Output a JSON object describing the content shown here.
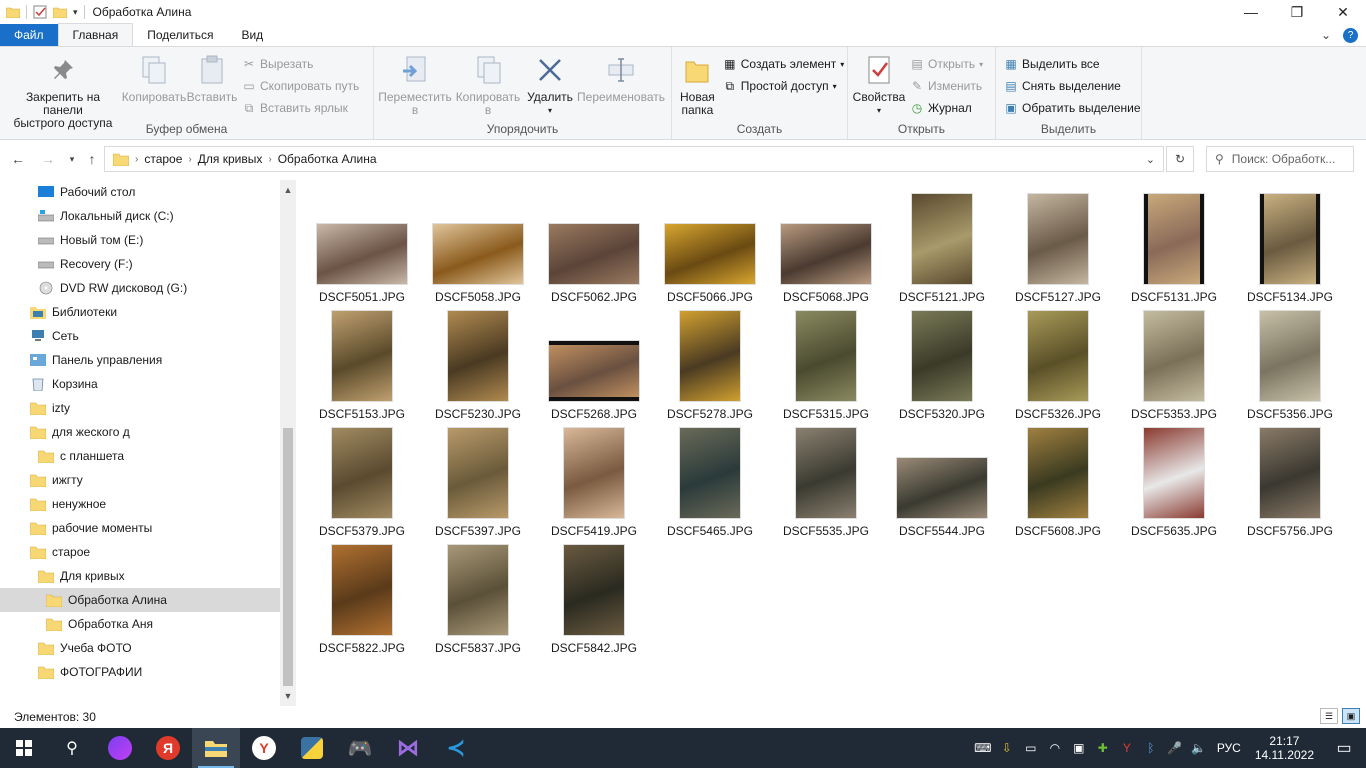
{
  "window": {
    "title": "Обработка Алина",
    "minimize": "—",
    "maximize": "❐",
    "close": "✕"
  },
  "menu": {
    "file": "Файл",
    "tabs": [
      "Главная",
      "Поделиться",
      "Вид"
    ],
    "active_tab": "Главная"
  },
  "ribbon": {
    "clipboard": {
      "group": "Буфер обмена",
      "pin": "Закрепить на панели быстрого доступа",
      "pin_l1": "Закрепить на панели",
      "pin_l2": "быстрого доступа",
      "copy": "Копировать",
      "paste": "Вставить",
      "cut": "Вырезать",
      "copy_path": "Скопировать путь",
      "paste_shortcut": "Вставить ярлык"
    },
    "organize": {
      "group": "Упорядочить",
      "move_l1": "Переместить",
      "move_l2": "в",
      "copyto_l1": "Копировать",
      "copyto_l2": "в",
      "delete": "Удалить",
      "rename": "Переименовать"
    },
    "new": {
      "group": "Создать",
      "new_folder_l1": "Новая",
      "new_folder_l2": "папка",
      "new_item": "Создать элемент",
      "easy_access": "Простой доступ"
    },
    "open": {
      "group": "Открыть",
      "properties": "Свойства",
      "open": "Открыть",
      "edit": "Изменить",
      "history": "Журнал"
    },
    "select": {
      "group": "Выделить",
      "select_all": "Выделить все",
      "select_none": "Снять выделение",
      "invert": "Обратить выделение"
    }
  },
  "address": {
    "crumbs": [
      "старое",
      "Для кривых",
      "Обработка Алина"
    ],
    "search_placeholder": "Поиск: Обработк..."
  },
  "nav": [
    {
      "label": "Рабочий стол",
      "icon": "desktop-icon",
      "x": 38
    },
    {
      "label": "Локальный диск (C:)",
      "icon": "drive-c-icon",
      "x": 38
    },
    {
      "label": "Новый том (E:)",
      "icon": "drive-icon",
      "x": 38
    },
    {
      "label": "Recovery (F:)",
      "icon": "drive-icon",
      "x": 38
    },
    {
      "label": "DVD RW дисковод (G:)",
      "icon": "dvd-icon",
      "x": 38
    },
    {
      "label": "Библиотеки",
      "icon": "libraries-icon",
      "x": 30
    },
    {
      "label": "Сеть",
      "icon": "network-icon",
      "x": 30
    },
    {
      "label": "Панель управления",
      "icon": "control-panel-icon",
      "x": 30
    },
    {
      "label": "Корзина",
      "icon": "recycle-bin-icon",
      "x": 30
    },
    {
      "label": "izty",
      "icon": "folder-icon",
      "x": 30
    },
    {
      "label": "для жеского д",
      "icon": "folder-icon",
      "x": 30
    },
    {
      "label": "с планшета",
      "icon": "folder-icon",
      "x": 38
    },
    {
      "label": "ижгту",
      "icon": "folder-icon",
      "x": 30
    },
    {
      "label": "ненужное",
      "icon": "folder-icon",
      "x": 30
    },
    {
      "label": "рабочие моменты",
      "icon": "folder-icon",
      "x": 30
    },
    {
      "label": "старое",
      "icon": "folder-icon",
      "x": 30
    },
    {
      "label": "Для кривых",
      "icon": "folder-icon",
      "x": 38
    },
    {
      "label": "Обработка Алина",
      "icon": "folder-icon",
      "x": 46,
      "selected": true
    },
    {
      "label": "Обработка Аня",
      "icon": "folder-icon",
      "x": 46
    },
    {
      "label": "Учеба ФОТО",
      "icon": "folder-icon",
      "x": 38
    },
    {
      "label": "ФОТОГРАФИИ",
      "icon": "folder-icon",
      "x": 38
    }
  ],
  "files": [
    {
      "name": "DSCF5051.JPG",
      "orient": "l",
      "c1": "#6b5345",
      "c2": "#c9b8a8"
    },
    {
      "name": "DSCF5058.JPG",
      "orient": "l",
      "c1": "#8a5a1c",
      "c2": "#e0c59a"
    },
    {
      "name": "DSCF5062.JPG",
      "orient": "l",
      "c1": "#5b4438",
      "c2": "#9a7a60"
    },
    {
      "name": "DSCF5066.JPG",
      "orient": "l",
      "c1": "#6a4a12",
      "c2": "#d8a630"
    },
    {
      "name": "DSCF5068.JPG",
      "orient": "l",
      "c1": "#4a3a30",
      "c2": "#b89a80"
    },
    {
      "name": "DSCF5121.JPG",
      "orient": "p",
      "c1": "#a89a6a",
      "c2": "#5a4a30"
    },
    {
      "name": "DSCF5127.JPG",
      "orient": "p",
      "c1": "#6a5a48",
      "c2": "#c4b6a0"
    },
    {
      "name": "DSCF5131.JPG",
      "orient": "p",
      "c1": "#8a6a58",
      "c2": "#c8a87a",
      "dark": true
    },
    {
      "name": "DSCF5134.JPG",
      "orient": "p",
      "c1": "#6a5a40",
      "c2": "#c8b080",
      "dark": true
    },
    {
      "name": "DSCF5153.JPG",
      "orient": "p",
      "c1": "#5a4a2a",
      "c2": "#c0a070"
    },
    {
      "name": "DSCF5230.JPG",
      "orient": "p",
      "c1": "#4a3a22",
      "c2": "#b08a50"
    },
    {
      "name": "DSCF5268.JPG",
      "orient": "w",
      "c1": "#6a5040",
      "c2": "#c09060"
    },
    {
      "name": "DSCF5278.JPG",
      "orient": "p",
      "c1": "#4a3a22",
      "c2": "#d0a030"
    },
    {
      "name": "DSCF5315.JPG",
      "orient": "p",
      "c1": "#4a4a30",
      "c2": "#8a8a60"
    },
    {
      "name": "DSCF5320.JPG",
      "orient": "p",
      "c1": "#3a3a28",
      "c2": "#7a7a58"
    },
    {
      "name": "DSCF5326.JPG",
      "orient": "p",
      "c1": "#5a5028",
      "c2": "#a89a58"
    },
    {
      "name": "DSCF5353.JPG",
      "orient": "p",
      "c1": "#7a7058",
      "c2": "#c4bca0"
    },
    {
      "name": "DSCF5356.JPG",
      "orient": "p",
      "c1": "#7a7460",
      "c2": "#c8c0a8"
    },
    {
      "name": "DSCF5379.JPG",
      "orient": "p",
      "c1": "#5a4a30",
      "c2": "#a08a60"
    },
    {
      "name": "DSCF5397.JPG",
      "orient": "p",
      "c1": "#6a5a3a",
      "c2": "#b89a6a"
    },
    {
      "name": "DSCF5419.JPG",
      "orient": "p",
      "c1": "#7a5a40",
      "c2": "#d8b898"
    },
    {
      "name": "DSCF5465.JPG",
      "orient": "p",
      "c1": "#2a3a3a",
      "c2": "#6a6a58"
    },
    {
      "name": "DSCF5535.JPG",
      "orient": "p",
      "c1": "#3a3a30",
      "c2": "#8a8070"
    },
    {
      "name": "DSCF5544.JPG",
      "orient": "l",
      "c1": "#3a3a30",
      "c2": "#9a8a78"
    },
    {
      "name": "DSCF5608.JPG",
      "orient": "p",
      "c1": "#3a3a20",
      "c2": "#a08040"
    },
    {
      "name": "DSCF5635.JPG",
      "orient": "p",
      "c1": "#e8e8e8",
      "c2": "#8a3a30"
    },
    {
      "name": "DSCF5756.JPG",
      "orient": "p",
      "c1": "#3a3830",
      "c2": "#8a7a68"
    },
    {
      "name": "DSCF5822.JPG",
      "orient": "p",
      "c1": "#5a3a1a",
      "c2": "#b07030"
    },
    {
      "name": "DSCF5837.JPG",
      "orient": "p",
      "c1": "#5a5038",
      "c2": "#a89878"
    },
    {
      "name": "DSCF5842.JPG",
      "orient": "p",
      "c1": "#2a2a20",
      "c2": "#6a5a40"
    }
  ],
  "status": {
    "items_count": "Элементов: 30"
  },
  "taskbar": {
    "time": "21:17",
    "date": "14.11.2022",
    "lang": "РУС"
  },
  "colors": {
    "accent": "#1a6fc9",
    "taskbar": "#1f2a36",
    "folder": "#f8d775"
  }
}
